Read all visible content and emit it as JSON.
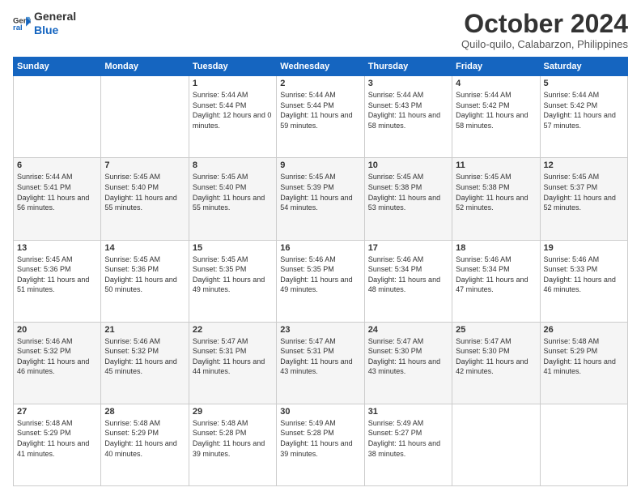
{
  "logo": {
    "line1": "General",
    "line2": "Blue"
  },
  "header": {
    "title": "October 2024",
    "subtitle": "Quilo-quilo, Calabarzon, Philippines"
  },
  "weekdays": [
    "Sunday",
    "Monday",
    "Tuesday",
    "Wednesday",
    "Thursday",
    "Friday",
    "Saturday"
  ],
  "weeks": [
    [
      {
        "day": "",
        "sunrise": "",
        "sunset": "",
        "daylight": ""
      },
      {
        "day": "",
        "sunrise": "",
        "sunset": "",
        "daylight": ""
      },
      {
        "day": "1",
        "sunrise": "Sunrise: 5:44 AM",
        "sunset": "Sunset: 5:44 PM",
        "daylight": "Daylight: 12 hours and 0 minutes."
      },
      {
        "day": "2",
        "sunrise": "Sunrise: 5:44 AM",
        "sunset": "Sunset: 5:44 PM",
        "daylight": "Daylight: 11 hours and 59 minutes."
      },
      {
        "day": "3",
        "sunrise": "Sunrise: 5:44 AM",
        "sunset": "Sunset: 5:43 PM",
        "daylight": "Daylight: 11 hours and 58 minutes."
      },
      {
        "day": "4",
        "sunrise": "Sunrise: 5:44 AM",
        "sunset": "Sunset: 5:42 PM",
        "daylight": "Daylight: 11 hours and 58 minutes."
      },
      {
        "day": "5",
        "sunrise": "Sunrise: 5:44 AM",
        "sunset": "Sunset: 5:42 PM",
        "daylight": "Daylight: 11 hours and 57 minutes."
      }
    ],
    [
      {
        "day": "6",
        "sunrise": "Sunrise: 5:44 AM",
        "sunset": "Sunset: 5:41 PM",
        "daylight": "Daylight: 11 hours and 56 minutes."
      },
      {
        "day": "7",
        "sunrise": "Sunrise: 5:45 AM",
        "sunset": "Sunset: 5:40 PM",
        "daylight": "Daylight: 11 hours and 55 minutes."
      },
      {
        "day": "8",
        "sunrise": "Sunrise: 5:45 AM",
        "sunset": "Sunset: 5:40 PM",
        "daylight": "Daylight: 11 hours and 55 minutes."
      },
      {
        "day": "9",
        "sunrise": "Sunrise: 5:45 AM",
        "sunset": "Sunset: 5:39 PM",
        "daylight": "Daylight: 11 hours and 54 minutes."
      },
      {
        "day": "10",
        "sunrise": "Sunrise: 5:45 AM",
        "sunset": "Sunset: 5:38 PM",
        "daylight": "Daylight: 11 hours and 53 minutes."
      },
      {
        "day": "11",
        "sunrise": "Sunrise: 5:45 AM",
        "sunset": "Sunset: 5:38 PM",
        "daylight": "Daylight: 11 hours and 52 minutes."
      },
      {
        "day": "12",
        "sunrise": "Sunrise: 5:45 AM",
        "sunset": "Sunset: 5:37 PM",
        "daylight": "Daylight: 11 hours and 52 minutes."
      }
    ],
    [
      {
        "day": "13",
        "sunrise": "Sunrise: 5:45 AM",
        "sunset": "Sunset: 5:36 PM",
        "daylight": "Daylight: 11 hours and 51 minutes."
      },
      {
        "day": "14",
        "sunrise": "Sunrise: 5:45 AM",
        "sunset": "Sunset: 5:36 PM",
        "daylight": "Daylight: 11 hours and 50 minutes."
      },
      {
        "day": "15",
        "sunrise": "Sunrise: 5:45 AM",
        "sunset": "Sunset: 5:35 PM",
        "daylight": "Daylight: 11 hours and 49 minutes."
      },
      {
        "day": "16",
        "sunrise": "Sunrise: 5:46 AM",
        "sunset": "Sunset: 5:35 PM",
        "daylight": "Daylight: 11 hours and 49 minutes."
      },
      {
        "day": "17",
        "sunrise": "Sunrise: 5:46 AM",
        "sunset": "Sunset: 5:34 PM",
        "daylight": "Daylight: 11 hours and 48 minutes."
      },
      {
        "day": "18",
        "sunrise": "Sunrise: 5:46 AM",
        "sunset": "Sunset: 5:34 PM",
        "daylight": "Daylight: 11 hours and 47 minutes."
      },
      {
        "day": "19",
        "sunrise": "Sunrise: 5:46 AM",
        "sunset": "Sunset: 5:33 PM",
        "daylight": "Daylight: 11 hours and 46 minutes."
      }
    ],
    [
      {
        "day": "20",
        "sunrise": "Sunrise: 5:46 AM",
        "sunset": "Sunset: 5:32 PM",
        "daylight": "Daylight: 11 hours and 46 minutes."
      },
      {
        "day": "21",
        "sunrise": "Sunrise: 5:46 AM",
        "sunset": "Sunset: 5:32 PM",
        "daylight": "Daylight: 11 hours and 45 minutes."
      },
      {
        "day": "22",
        "sunrise": "Sunrise: 5:47 AM",
        "sunset": "Sunset: 5:31 PM",
        "daylight": "Daylight: 11 hours and 44 minutes."
      },
      {
        "day": "23",
        "sunrise": "Sunrise: 5:47 AM",
        "sunset": "Sunset: 5:31 PM",
        "daylight": "Daylight: 11 hours and 43 minutes."
      },
      {
        "day": "24",
        "sunrise": "Sunrise: 5:47 AM",
        "sunset": "Sunset: 5:30 PM",
        "daylight": "Daylight: 11 hours and 43 minutes."
      },
      {
        "day": "25",
        "sunrise": "Sunrise: 5:47 AM",
        "sunset": "Sunset: 5:30 PM",
        "daylight": "Daylight: 11 hours and 42 minutes."
      },
      {
        "day": "26",
        "sunrise": "Sunrise: 5:48 AM",
        "sunset": "Sunset: 5:29 PM",
        "daylight": "Daylight: 11 hours and 41 minutes."
      }
    ],
    [
      {
        "day": "27",
        "sunrise": "Sunrise: 5:48 AM",
        "sunset": "Sunset: 5:29 PM",
        "daylight": "Daylight: 11 hours and 41 minutes."
      },
      {
        "day": "28",
        "sunrise": "Sunrise: 5:48 AM",
        "sunset": "Sunset: 5:29 PM",
        "daylight": "Daylight: 11 hours and 40 minutes."
      },
      {
        "day": "29",
        "sunrise": "Sunrise: 5:48 AM",
        "sunset": "Sunset: 5:28 PM",
        "daylight": "Daylight: 11 hours and 39 minutes."
      },
      {
        "day": "30",
        "sunrise": "Sunrise: 5:49 AM",
        "sunset": "Sunset: 5:28 PM",
        "daylight": "Daylight: 11 hours and 39 minutes."
      },
      {
        "day": "31",
        "sunrise": "Sunrise: 5:49 AM",
        "sunset": "Sunset: 5:27 PM",
        "daylight": "Daylight: 11 hours and 38 minutes."
      },
      {
        "day": "",
        "sunrise": "",
        "sunset": "",
        "daylight": ""
      },
      {
        "day": "",
        "sunrise": "",
        "sunset": "",
        "daylight": ""
      }
    ]
  ]
}
